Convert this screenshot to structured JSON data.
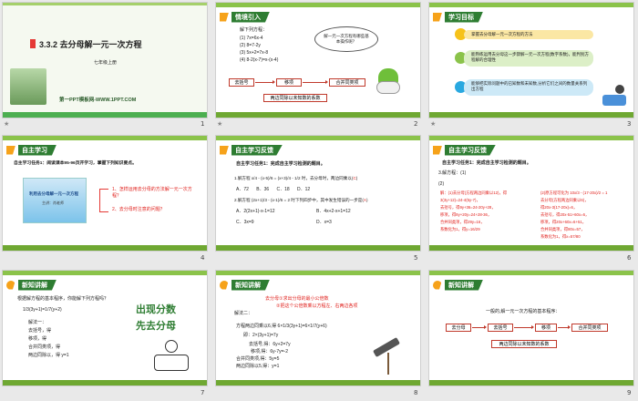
{
  "s1": {
    "title": "3.3.2 去分母解一元一次方程",
    "sub": "七年级上册",
    "footer": "第一PPT模板网-WWW.1PPT.COM"
  },
  "s2": {
    "header": "情境引入",
    "intro": "解下列方程：",
    "eqs": [
      "(1) 7x=6x-4",
      "(2) 8=7-2y",
      "(3) 5x+2=7x-8",
      "(4) 8-2(x-7)=x-(x-4)"
    ],
    "bubble": "解一元一次方程有哪些基本操作呢？",
    "steps": [
      "去括号",
      "移项",
      "合并同类项"
    ],
    "last": "两边同除以未知数的系数"
  },
  "s3": {
    "header": "学习目标",
    "goals": [
      "掌握去分母解一元一次方程的方法",
      "能熟练运用去分母这一步骤解一元一次方程(数字系数)，能判别方程解的合理性",
      "能够把实际问题中的已知数和未知数,分析它们之间的数量关系列出方程"
    ]
  },
  "s4": {
    "header": "自主学习",
    "task": "自主学习任务1：阅读课本95-96页开学习，掌握下列知识要点。",
    "book": "利用去分母解一元一次方程",
    "author": "主讲：肖老师",
    "items": [
      "1、怎样运用去分母的方法解一元一次方程？",
      "2、去分母时注意的问题？"
    ]
  },
  "s5": {
    "header": "自主学习反馈",
    "task": "自主学习任务1：完成自主学习检测的题目。",
    "q1": "1.解方程 x/4 - (x-5)/6 = (x+3)/4 - 1/2 时，去分母时，两边同乘以(",
    "a1": "C",
    "opts1": [
      "A．72",
      "B．36",
      "C．18",
      "D．12"
    ],
    "q2": "2.解方程 (2x+1)/3 - (x-1)/6 = 2 时下列四步中，其中发生错误的一步是(",
    "a2": "A",
    "opts2": [
      "A．2(2x+1)-x-1=12",
      "B．4x+2-x+1=12",
      "C．3x=9",
      "D．x=3"
    ]
  },
  "s6": {
    "header": "自主学习反馈",
    "task": "自主学习任务1：完成自主学习检测的题目。",
    "q3": "3.解方程：(1)",
    "q3b": "(2)",
    "left": [
      "解：(1)去分母(方程两边同乘以12)，得",
      "3(3y+12)=24-4(5y-7)，",
      "去括号，得9y+36=24-20y+28，",
      "移项，得9y+20y=24+28-36，",
      "合并同类项，得29y=16，",
      "系数化为1，得y=16/29"
    ],
    "right": [
      "(2)原方程可化为 10x/3 - (17-20x)/2 = 1",
      "去分母(方程两边同乘以6)，",
      "得20x-3(17-20x)=6，",
      "去括号，得20x-51+60x=6，",
      "移项，得20x+60x=6+51，",
      "合并同类项，得80x=57，",
      "系数化为1，得x=57/80"
    ]
  },
  "s7": {
    "header": "新知讲解",
    "q": "根据解方程的基本程序，你能解下列方程吗？",
    "eq": "1/3(3y+1)=1/7(y+2)",
    "steps": [
      "解法一：",
      "去括号，得",
      "移项，得",
      "合并同类项，得",
      "两边同除以，得 y=1"
    ],
    "cal1": "出现分数",
    "cal2": "先去分母"
  },
  "s8": {
    "header": "新知讲解",
    "tips": [
      "去分母①求出分母的最小公倍数",
      "②把这个公倍数乘以方程左、右两边各项"
    ],
    "sol": "解法二：",
    "lines": [
      "方程两边同乘以6,得 6×1/3(3y+1)=6×1/7(y+6)",
      "即：2×(3y+1)=7y",
      "去括号,得：6y+2=7y",
      "移项,得：6y-7y=-2",
      "合并同类项,得：5y=5",
      "两边同除以5,得：y=1"
    ]
  },
  "s9": {
    "header": "新知讲解",
    "intro": "一般的,解一元一次方程的基本程序：",
    "steps": [
      "去分母",
      "去括号",
      "移项",
      "合并同类项"
    ],
    "last": "两边同除以未知数的系数"
  },
  "nums": [
    "1",
    "2",
    "3",
    "4",
    "5",
    "6",
    "7",
    "8",
    "9"
  ]
}
